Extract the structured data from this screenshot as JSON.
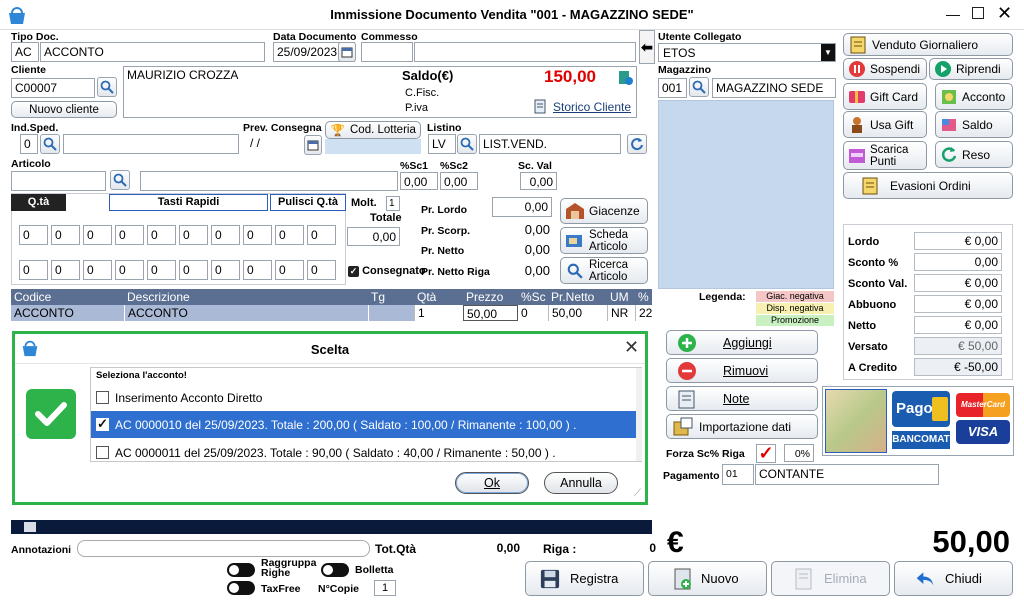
{
  "window": {
    "title": "Immissione Documento Vendita \"001 - MAGAZZINO SEDE\""
  },
  "labels": {
    "tipo_doc": "Tipo Doc.",
    "data_doc": "Data Documento",
    "commesso": "Commesso",
    "utente": "Utente Collegato",
    "cliente": "Cliente",
    "magazzino": "Magazzino",
    "ind_sped": "Ind.Sped.",
    "prev_consegna": "Prev. Consegna",
    "listino": "Listino",
    "articolo": "Articolo",
    "sc1": "%Sc1",
    "sc2": "%Sc2",
    "scval": "Sc. Val",
    "qta": "Q.tà",
    "tasti_rapidi": "Tasti Rapidi",
    "pulisci_qta": "Pulisci Q.tà",
    "molt": "Molt.",
    "totale": "Totale",
    "pr_lordo": "Pr. Lordo",
    "pr_scorp": "Pr. Scorp.",
    "pr_netto": "Pr. Netto",
    "pr_netto_riga": "Pr. Netto Riga",
    "consegnato": "Consegnato",
    "legenda": "Legenda:",
    "saldo": "Saldo(€)",
    "cfisc": "C.Fisc.",
    "piva": "P.iva",
    "annotazioni": "Annotazioni",
    "tot_qta": "Tot.Qtà",
    "riga": "Riga :",
    "raggruppa": "Raggruppa Righe",
    "bolletta": "Bolletta",
    "taxfree": "TaxFree",
    "ncopie": "N°Copie",
    "forza_sc": "Forza Sc% Riga",
    "pagamento": "Pagamento"
  },
  "fields": {
    "tipo_code": "AC",
    "tipo_desc": "ACCONTO",
    "data_doc": "25/09/2023",
    "commesso": "",
    "utente": "ETOS",
    "cliente_code": "C00007",
    "cliente_name": "MAURIZIO CROZZA",
    "saldo_value": "150,00",
    "magazzino_code": "001",
    "magazzino_desc": "MAGAZZINO SEDE",
    "ind_sped": "0",
    "prev_consegna": "/ /",
    "listino_code": "LV",
    "listino_desc": "LIST.VEND.",
    "sc1": "0,00",
    "sc2": "0,00",
    "scval": "0,00",
    "molt": "1",
    "totale": "0,00",
    "pr_lordo": "0,00",
    "pr_scorp": "0,00",
    "pr_netto": "0,00",
    "pr_netto_riga": "0,00",
    "forza_pct": "0%",
    "pag_code": "01",
    "pag_desc": "CONTANTE",
    "tot_qta": "0,00",
    "riga": "0",
    "ncopie": "1",
    "big_currency": "€",
    "big_total": "50,00"
  },
  "qty_row1": [
    "0",
    "0",
    "0",
    "0",
    "0",
    "0",
    "0",
    "0",
    "0",
    "0"
  ],
  "qty_row2": [
    "0",
    "0",
    "0",
    "0",
    "0",
    "0",
    "0",
    "0",
    "0",
    "0"
  ],
  "buttons": {
    "nuovo_cliente": "Nuovo cliente",
    "storico_cliente": "Storico Cliente",
    "cod_lotteria": "Cod. Lotteria",
    "giacenze": "Giacenze",
    "scheda_articolo": "Scheda Articolo",
    "ricerca_articolo": "Ricerca Articolo",
    "venduto": "Venduto Giornaliero",
    "sospendi": "Sospendi",
    "riprendi": "Riprendi",
    "gift_card": "Gift Card",
    "acconto": "Acconto",
    "usa_gift": "Usa Gift",
    "saldo": "Saldo",
    "scarica_punti": "Scarica Punti",
    "reso": "Reso",
    "evasioni": "Evasioni Ordini",
    "aggiungi": "Aggiungi",
    "rimuovi": "Rimuovi",
    "note": "Note",
    "importazione": "Importazione dati",
    "registra": "Registra",
    "nuovo": "Nuovo",
    "elimina": "Elimina",
    "chiudi": "Chiudi"
  },
  "legend": [
    {
      "label": "Giac. negativa",
      "color": "#f4c6c6"
    },
    {
      "label": "Disp. negativa",
      "color": "#f7f0b0"
    },
    {
      "label": "Promozione",
      "color": "#c9f0c0"
    }
  ],
  "totals": [
    {
      "label": "Lordo",
      "value": "€ 0,00"
    },
    {
      "label": "Sconto %",
      "value": "0,00"
    },
    {
      "label": "Sconto Val.",
      "value": "€ 0,00"
    },
    {
      "label": "Abbuono",
      "value": "€ 0,00"
    },
    {
      "label": "Netto",
      "value": "€ 0,00"
    },
    {
      "label": "Versato",
      "value": "€ 50,00"
    },
    {
      "label": "A Credito",
      "value": "€ -50,00"
    }
  ],
  "grid": {
    "headers": [
      "Codice",
      "Descrizione",
      "Tg",
      "Qtà",
      "Prezzo",
      "%Sc",
      "Pr.Netto",
      "UM",
      "%"
    ],
    "rows": [
      [
        "ACCONTO",
        "ACCONTO",
        "",
        "1",
        "50,00",
        "0",
        "50,00",
        "NR",
        "22"
      ]
    ]
  },
  "payment_logos": {
    "pago": "Pago",
    "bancomat": "BANCOMAT",
    "mastercard": "MasterCard",
    "visa": "VISA"
  },
  "dialog": {
    "title": "Scelta",
    "prompt": "Seleziona l'acconto!",
    "options": [
      {
        "label": "Inserimento Acconto Diretto",
        "checked": false
      },
      {
        "label": "AC 0000010 del 25/09/2023. Totale : 200,00 ( Saldato : 100,00 / Rimanente : 100,00 ) .",
        "checked": true
      },
      {
        "label": "AC 0000011 del 25/09/2023. Totale : 90,00 ( Saldato : 40,00 / Rimanente : 50,00 ) .",
        "checked": false
      }
    ],
    "ok": "Ok",
    "annulla": "Annulla"
  },
  "colors": {
    "accent_green": "#2db34a",
    "selection": "#2e6fcf",
    "red_value": "#e00000",
    "grid_header": "#5b6f92"
  }
}
